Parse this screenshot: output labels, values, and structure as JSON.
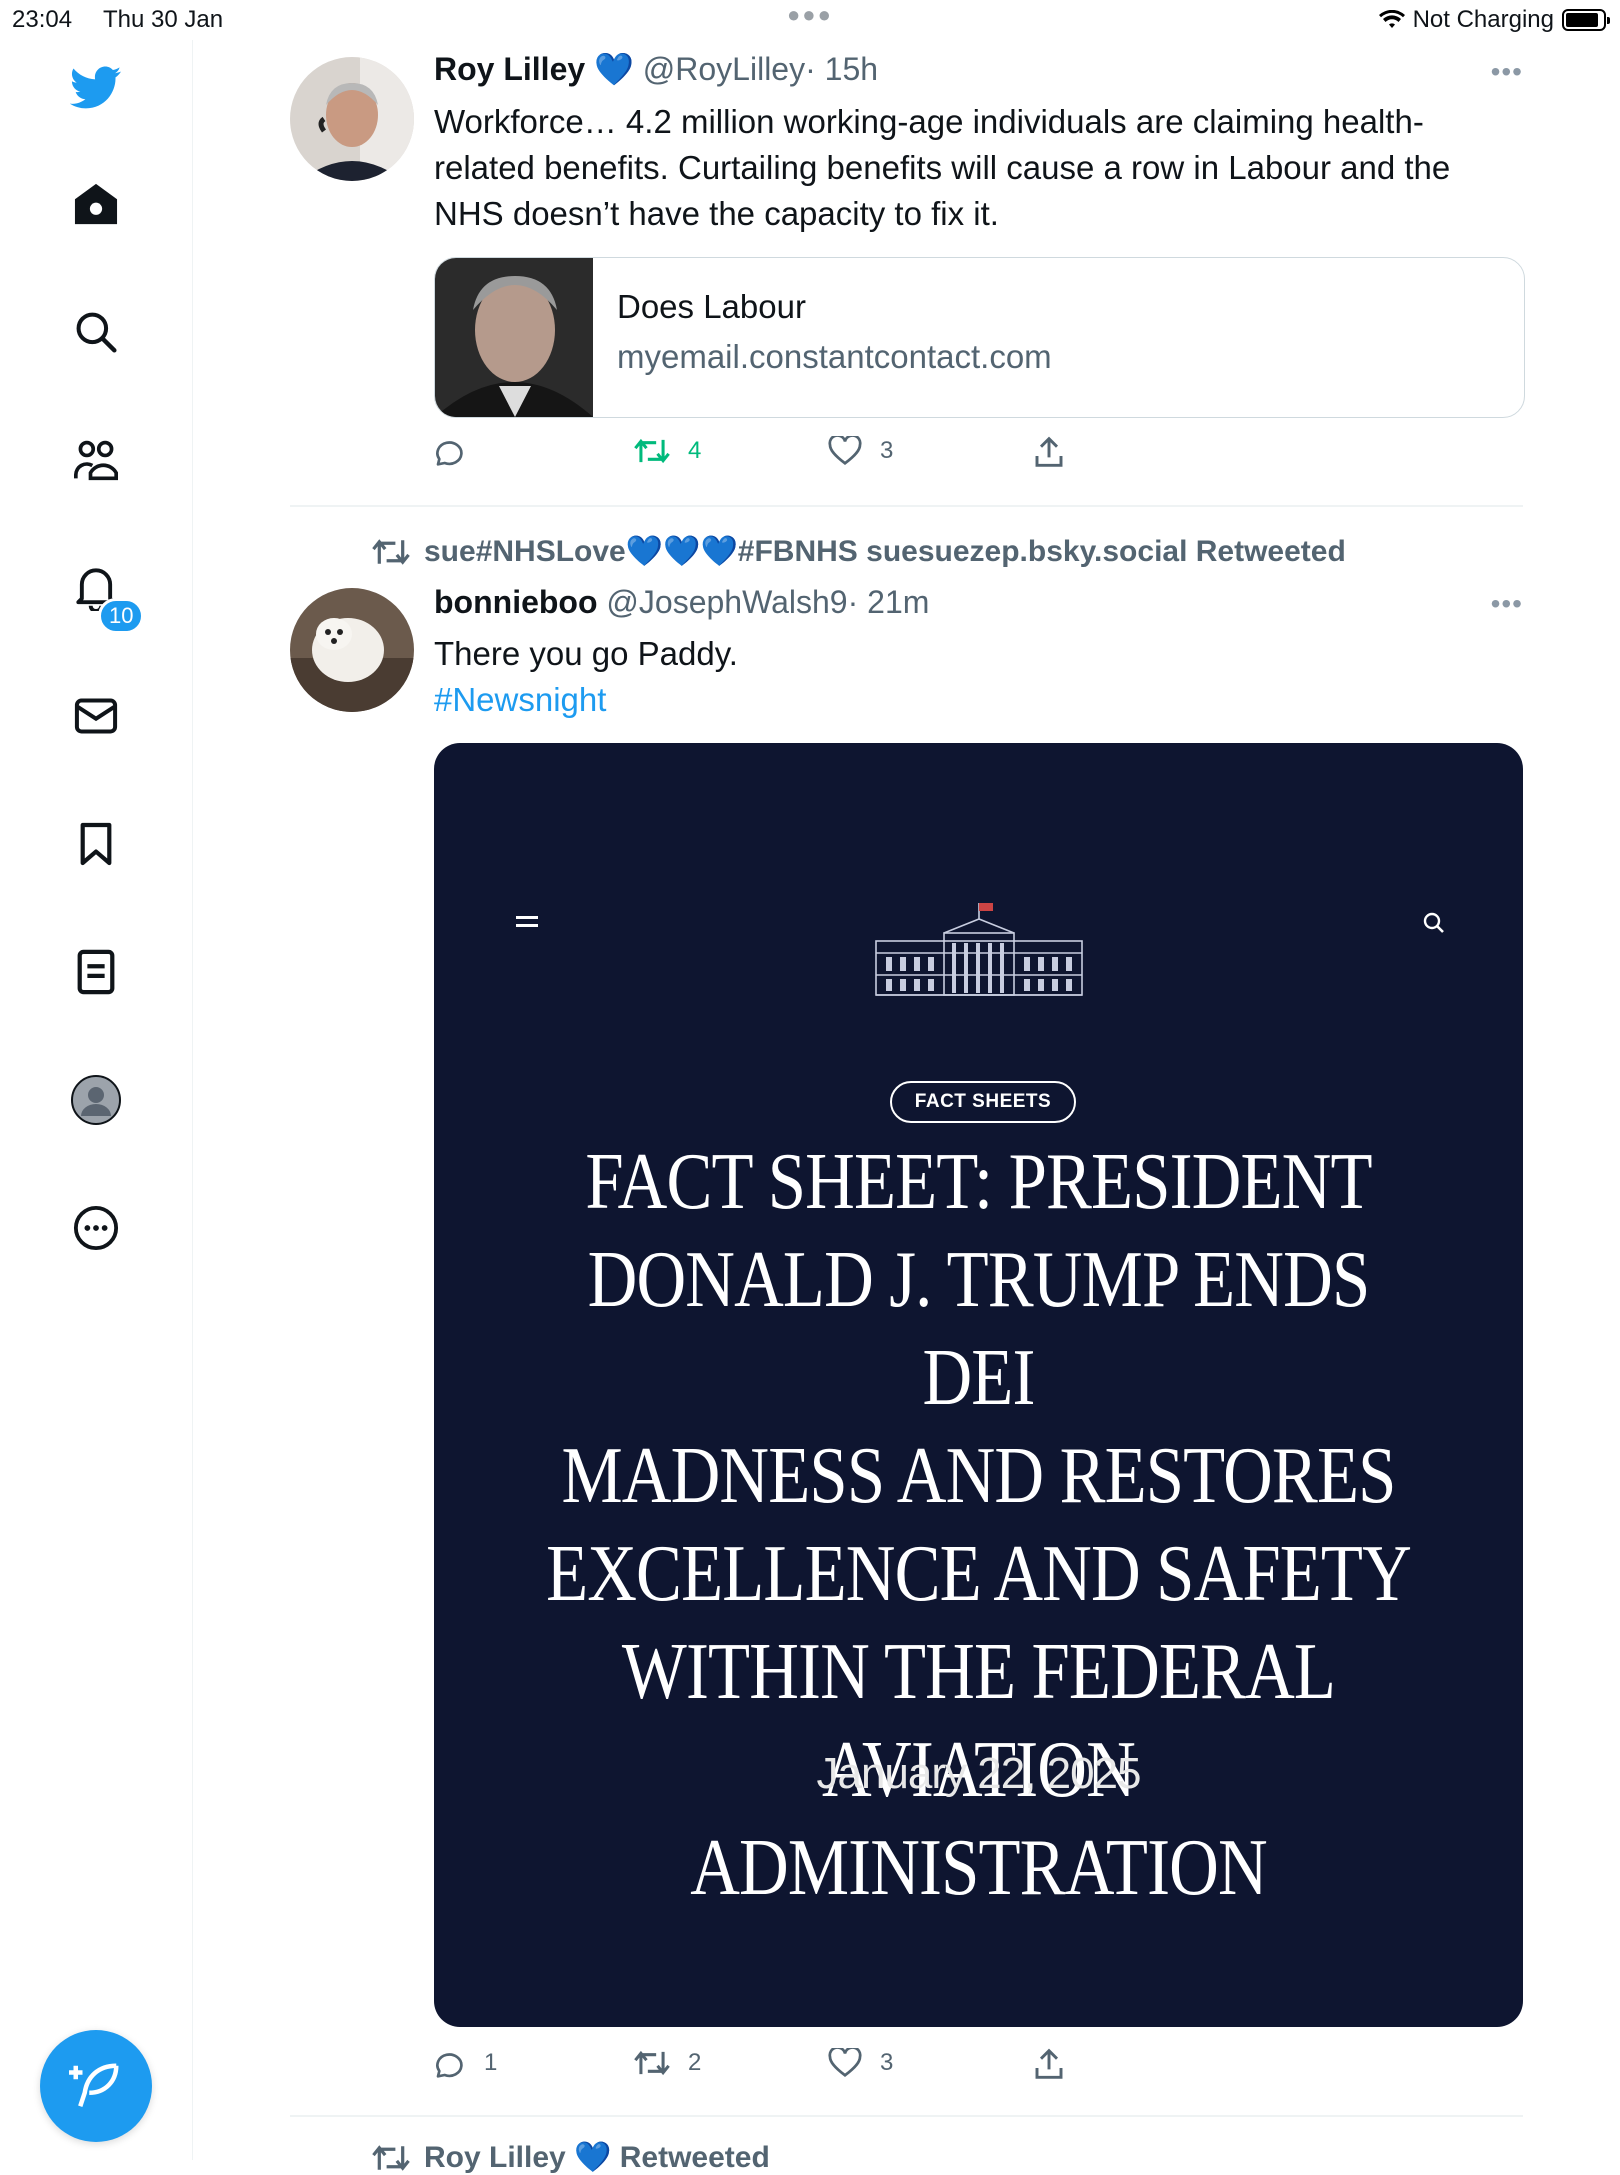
{
  "status_bar": {
    "time": "23:04",
    "date": "Thu 30 Jan",
    "charging": "Not Charging"
  },
  "sidebar": {
    "notification_count": "10",
    "items": [
      "twitter-logo",
      "home",
      "explore",
      "communities",
      "notifications",
      "messages",
      "bookmarks",
      "lists",
      "profile",
      "more"
    ]
  },
  "colors": {
    "accent": "#1d9bf0",
    "retweet_green": "#00ba7c",
    "media_bg": "#0e1530",
    "text_secondary": "#536471"
  },
  "tweets": [
    {
      "name": "Roy Lilley",
      "verified": "💙",
      "handle": "@RoyLilley",
      "time": "· 15h",
      "text_lines": [
        "Workforce… 4.2 million working-age individuals are claiming health-",
        "related benefits. Curtailing benefits will cause a row in Labour and the",
        "NHS doesn’t have the capacity to fix it."
      ],
      "card": {
        "title": "Does Labour",
        "domain": "myemail.constantcontact.com"
      },
      "replies": "",
      "retweets": "4",
      "likes": "3"
    },
    {
      "retweeted_by": "sue#NHSLove💙💙💙#FBNHS suesuezep.bsky.social Retweeted",
      "name": "bonnieboo",
      "handle": "@JosephWalsh9",
      "time": "· 21m",
      "text": "There you go Paddy.",
      "hashtag": "#Newsnight",
      "media": {
        "pill": "FACT SHEETS",
        "title_lines": [
          "FACT SHEET: PRESIDENT",
          "DONALD J. TRUMP ENDS DEI",
          "MADNESS AND RESTORES",
          "EXCELLENCE AND SAFETY",
          "WITHIN THE FEDERAL",
          "AVIATION ADMINISTRATION"
        ],
        "date": "January 22, 2025"
      },
      "replies": "1",
      "retweets": "2",
      "likes": "3"
    }
  ],
  "next_retweet": "Roy Lilley 💙 Retweeted"
}
